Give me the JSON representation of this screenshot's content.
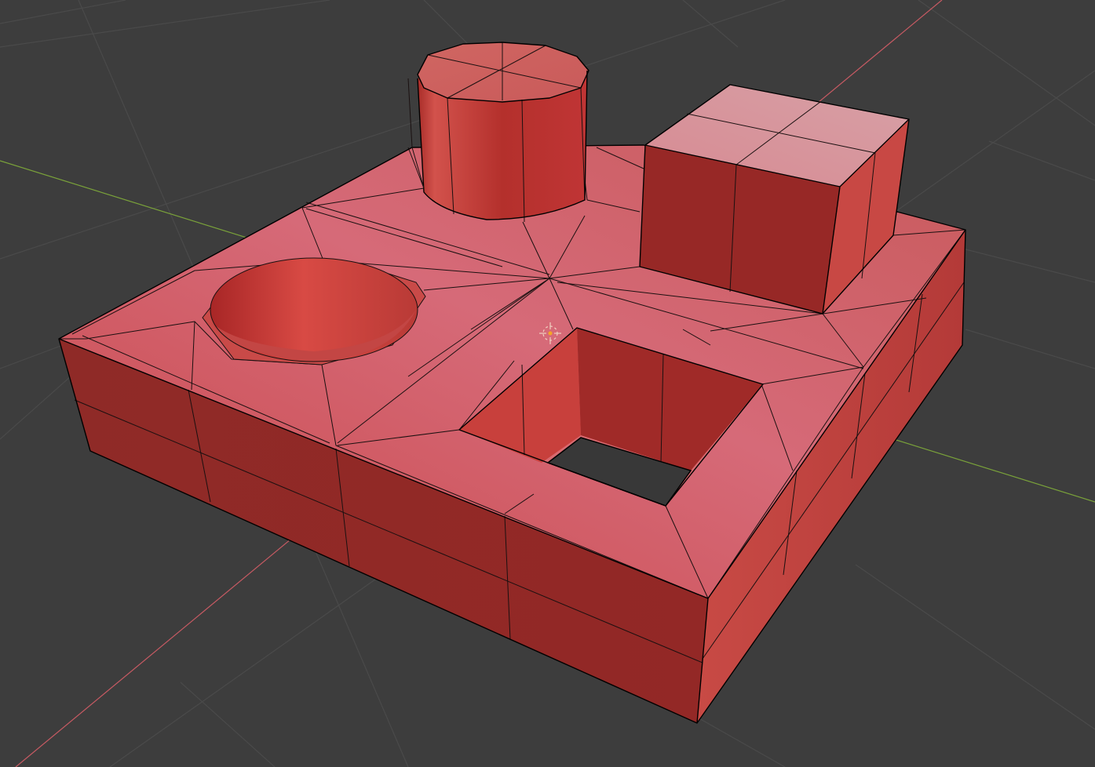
{
  "viewport": {
    "background_color": "#3d3d3d",
    "grid_color": "#4a4a4a",
    "x_axis_color": "#c75a63",
    "y_axis_color": "#7aa23a",
    "mesh_color": "#d9534f",
    "mesh_dark_color": "#8e2624",
    "hole_color": "#383838"
  },
  "objects": [
    {
      "name": "base-slab",
      "kind": "mesh"
    },
    {
      "name": "cylinder-boss",
      "kind": "mesh"
    },
    {
      "name": "cube-boss",
      "kind": "mesh"
    },
    {
      "name": "round-pocket",
      "kind": "mesh"
    },
    {
      "name": "square-through-hole",
      "kind": "mesh"
    },
    {
      "name": "origin-gizmo",
      "kind": "gizmo"
    }
  ]
}
